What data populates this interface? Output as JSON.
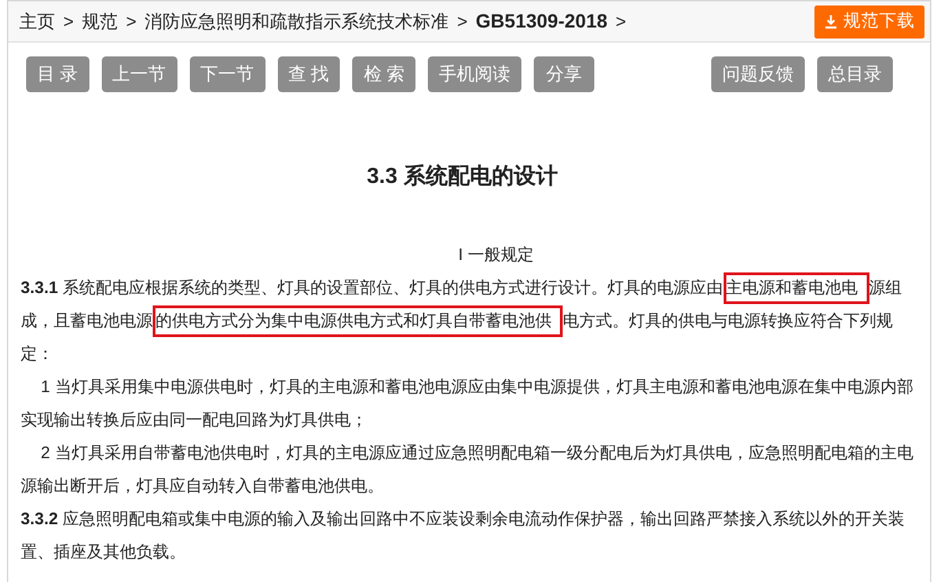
{
  "breadcrumb": {
    "items": [
      "主页",
      "规范",
      "消防应急照明和疏散指示系统技术标准"
    ],
    "code": "GB51309-2018",
    "separator": ">"
  },
  "download_button": {
    "label": "规范下载"
  },
  "toolbar": {
    "left": [
      "目 录",
      "上一节",
      "下一节",
      "查 找",
      "检 索",
      "手机阅读",
      "分享"
    ],
    "right": [
      "问题反馈",
      "总目录"
    ]
  },
  "section_title": "3.3 系统配电的设计",
  "paragraphs": [
    {
      "kind": "heading",
      "segments": [
        {
          "text": "I 一般规定",
          "highlighted": false
        }
      ]
    },
    {
      "kind": "clause",
      "segments": [
        {
          "text": "**3.3.1** 系统配电应根据系统的类型、灯具的设置部位、灯具的供电方式进行设计。灯具的电源应由",
          "highlighted": false
        },
        {
          "text": "主电源和蓄电池电",
          "highlighted": true
        },
        {
          "text": "源组成，且蓄电池电源",
          "highlighted": false
        },
        {
          "text": "的供电方式分为集中电源供电方式和灯具自带蓄电池供",
          "highlighted": true
        },
        {
          "text": "电方式。灯具的供电与电源转换应符合下列规定：",
          "highlighted": false
        }
      ]
    },
    {
      "kind": "item",
      "segments": [
        {
          "text": "1 当灯具采用集中电源供电时，灯具的主电源和蓄电池电源应由集中电源提供，灯具主电源和蓄电池电源在集中电源内部实现输出转换后应由同一配电回路为灯具供电；",
          "highlighted": false
        }
      ]
    },
    {
      "kind": "item",
      "segments": [
        {
          "text": "2 当灯具采用自带蓄电池供电时，灯具的主电源应通过应急照明配电箱一级分配电后为灯具供电，应急照明配电箱的主电源输出断开后，灯具应自动转入自带蓄电池供电。",
          "highlighted": false
        }
      ]
    },
    {
      "kind": "clause",
      "segments": [
        {
          "text": "**3.3.2** 应急照明配电箱或集中电源的输入及输出回路中不应装设剩余电流动作保护器，输出回路严禁接入系统以外的开关装置、插座及其他负载。",
          "highlighted": false
        }
      ]
    }
  ]
}
